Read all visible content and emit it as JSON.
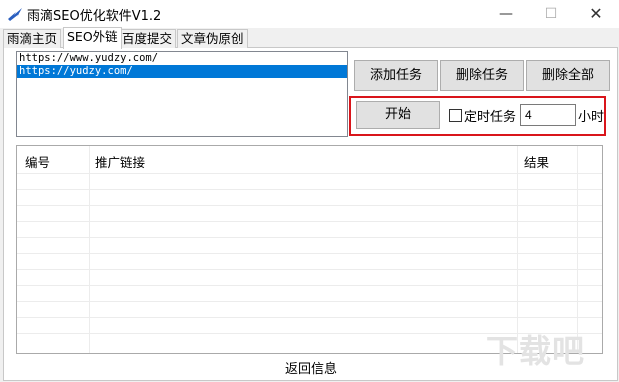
{
  "window": {
    "title": "雨滴SEO优化软件V1.2",
    "min_glyph": "—",
    "max_glyph": "☐",
    "close_glyph": "✕"
  },
  "tabs": [
    {
      "label": "雨滴主页"
    },
    {
      "label": "SEO外链"
    },
    {
      "label": "百度提交"
    },
    {
      "label": "文章伪原创"
    }
  ],
  "urls": [
    "https://www.yudzy.com/",
    "https://yudzy.com/"
  ],
  "buttons": {
    "add": "添加任务",
    "delete": "删除任务",
    "delete_all": "删除全部",
    "start": "开始"
  },
  "timer": {
    "label": "定时任务",
    "value": "4",
    "unit": "小时",
    "checked": false
  },
  "grid": {
    "columns": [
      "编号",
      "推广链接",
      "结果"
    ],
    "rows": []
  },
  "footer": "返回信息",
  "watermark": "下载吧"
}
